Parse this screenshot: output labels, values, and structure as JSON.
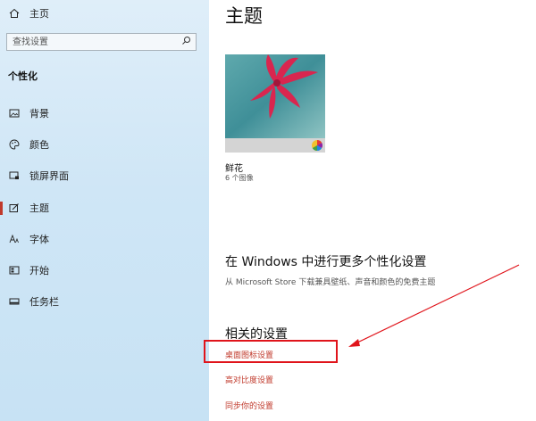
{
  "sidebar": {
    "home_label": "主页",
    "search_placeholder": "查找设置",
    "section_title": "个性化",
    "items": [
      {
        "label": "背景",
        "icon": "image-icon"
      },
      {
        "label": "颜色",
        "icon": "palette-icon"
      },
      {
        "label": "锁屏界面",
        "icon": "lock-screen-icon"
      },
      {
        "label": "主题",
        "icon": "theme-icon",
        "active": true
      },
      {
        "label": "字体",
        "icon": "font-icon"
      },
      {
        "label": "开始",
        "icon": "start-icon"
      },
      {
        "label": "任务栏",
        "icon": "taskbar-icon"
      }
    ]
  },
  "main": {
    "title": "主题",
    "theme": {
      "name": "鲜花",
      "count": "6 个图像"
    },
    "more": {
      "title": "在 Windows 中进行更多个性化设置",
      "link": "从 Microsoft Store 下载兼具壁纸、声音和颜色的免费主题"
    },
    "related": {
      "title": "相关的设置",
      "links": [
        "桌面图标设置",
        "高对比度设置",
        "同步你的设置"
      ]
    }
  },
  "colors": {
    "accent": "#c0392b",
    "annotation_red": "#e0141b",
    "sidebar_bg": "#cfe6f6"
  }
}
